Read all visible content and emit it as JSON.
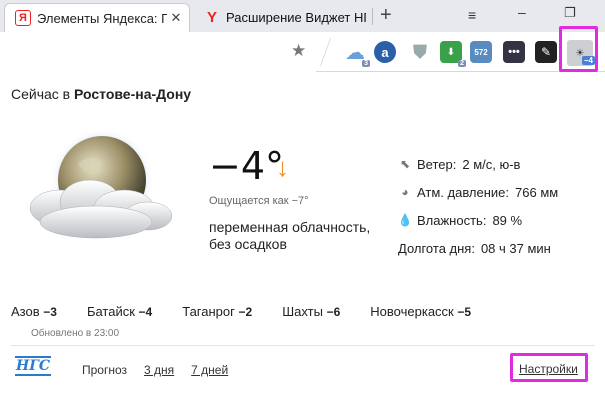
{
  "tabs": [
    {
      "title": "Элементы Яндекса: Г",
      "favicon": "Я"
    },
    {
      "title": "Расширение Виджет НГ",
      "favicon": "Y"
    }
  ],
  "tabstrip": {
    "new_tab_icon": "+",
    "menu_icon": "≡",
    "minimize_icon": "–",
    "restore_icon": "❐"
  },
  "extensions": {
    "cloud_badge": "3",
    "a_label": "a",
    "dl_badge": "2",
    "badge_572": "572",
    "dots_label": "•••",
    "weather_badge": "−4"
  },
  "popup": {
    "city_prefix": "Сейчас в",
    "city_name": "Ростове-на-Дону",
    "temperature": "−4°",
    "feels_like": "Ощущается как −7°",
    "condition": "переменная облачность, без осадков",
    "details": [
      {
        "label": "Ветер:",
        "value": "2 м/с, ю-в",
        "icon": "wind-arrow-icon"
      },
      {
        "label": "Атм. давление:",
        "value": "766  мм",
        "icon": "pressure-gauge-icon"
      },
      {
        "label": "Влажность:",
        "value": "89 %",
        "icon": "drop-icon"
      },
      {
        "label": "Долгота дня:",
        "value": "08 ч 37 мин",
        "icon": ""
      }
    ],
    "nearby": [
      {
        "name": "Азов",
        "temp": "−3"
      },
      {
        "name": "Батайск",
        "temp": "−4"
      },
      {
        "name": "Таганрог",
        "temp": "−2"
      },
      {
        "name": "Шахты",
        "temp": "−6"
      },
      {
        "name": "Новочеркасск",
        "temp": "−5"
      }
    ],
    "updated": "Обновлено в 23:00",
    "logo_text": "НГС",
    "forecast_label": "Прогноз",
    "forecast_3": "3 дня",
    "forecast_7": "7 дней",
    "settings_label": "Настройки"
  },
  "colors": {
    "highlight": "#e02be0",
    "arrow": "#f09020",
    "link_logo": "#2a7bd0"
  }
}
